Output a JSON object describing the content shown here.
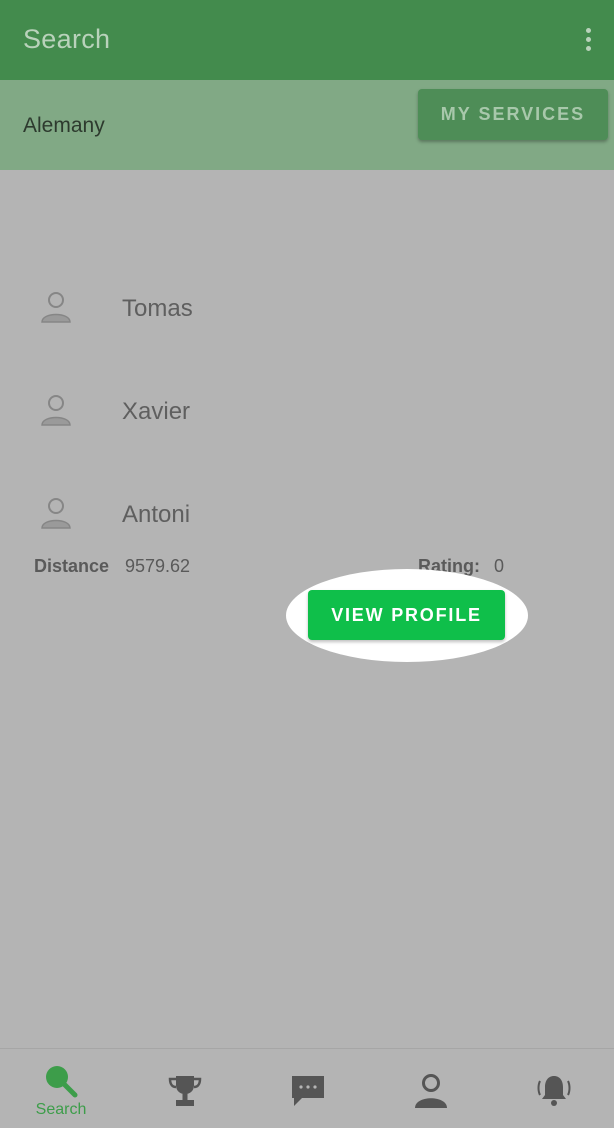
{
  "appbar": {
    "title": "Search",
    "menu_icon": "more-vert-icon"
  },
  "subheader": {
    "location": "Alemany",
    "my_services_label": "MY SERVICES"
  },
  "results": [
    {
      "name": "Tomas",
      "icon": "person-icon"
    },
    {
      "name": "Xavier",
      "icon": "person-icon"
    },
    {
      "name": "Antoni",
      "icon": "person-icon"
    }
  ],
  "expanded": {
    "distance_label": "Distance",
    "distance_value": "9579.62",
    "rating_label": "Rating:",
    "rating_value": "0",
    "view_profile_label": "VIEW PROFILE"
  },
  "bottom_nav": [
    {
      "label": "Search",
      "icon": "search-icon",
      "active": true
    },
    {
      "label": "",
      "icon": "trophy-icon",
      "active": false
    },
    {
      "label": "",
      "icon": "chat-icon",
      "active": false
    },
    {
      "label": "",
      "icon": "profile-icon",
      "active": false
    },
    {
      "label": "",
      "icon": "bell-icon",
      "active": false
    }
  ],
  "colors": {
    "appbar": "#438b4d",
    "accent_button": "#0fbf4a",
    "active_nav": "#3d9d4a",
    "inactive_nav": "#555555"
  }
}
